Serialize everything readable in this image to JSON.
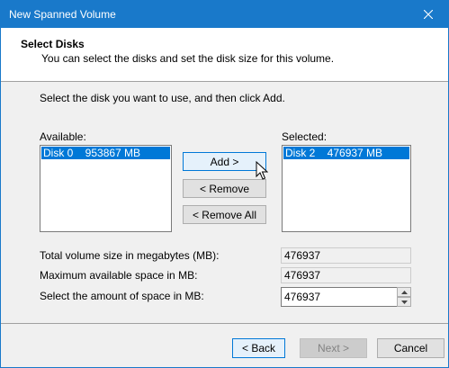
{
  "window": {
    "title": "New Spanned Volume"
  },
  "header": {
    "title": "Select Disks",
    "subtitle": "You can select the disks and set the disk size for this volume."
  },
  "instruction": "Select the disk you want to use, and then click Add.",
  "available": {
    "label": "Available:",
    "items": [
      "Disk 0    953867 MB"
    ]
  },
  "selected": {
    "label": "Selected:",
    "items": [
      "Disk 2    476937 MB"
    ]
  },
  "buttons": {
    "add": "Add >",
    "remove": "< Remove",
    "remove_all": "< Remove All",
    "back": "< Back",
    "next": "Next >",
    "cancel": "Cancel"
  },
  "sizes": {
    "total_label": "Total volume size in megabytes (MB):",
    "total_value": "476937",
    "max_label": "Maximum available space in MB:",
    "max_value": "476937",
    "amount_label": "Select the amount of space in MB:",
    "amount_value": "476937"
  },
  "colors": {
    "titlebar": "#1979ca",
    "selection": "#0078d7"
  }
}
